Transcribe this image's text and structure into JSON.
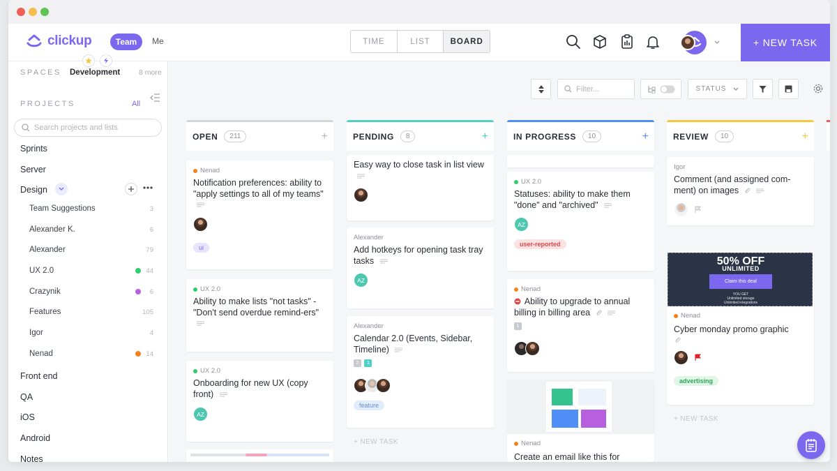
{
  "app": {
    "logo_text": "clickup",
    "team_label": "Team",
    "me_label": "Me",
    "new_task_label": "+ NEW TASK",
    "accent": "#7b68ee"
  },
  "views": [
    {
      "label": "TIME",
      "active": false
    },
    {
      "label": "LIST",
      "active": false
    },
    {
      "label": "BOARD",
      "active": true
    }
  ],
  "top_icons": [
    "search-icon",
    "box-icon",
    "clipboard-icon",
    "bell-icon"
  ],
  "sidebar": {
    "spaces_label": "SPACES",
    "space_name": "Development",
    "more_label": "8 more",
    "projects_label": "PROJECTS",
    "all_label": "All",
    "search_placeholder": "Search projects and lists",
    "projects": [
      {
        "label": "Sprints"
      },
      {
        "label": "Server"
      },
      {
        "label": "Design"
      }
    ],
    "design_lists": [
      {
        "label": "Team Suggestions",
        "count": "3",
        "color": ""
      },
      {
        "label": "Alexander K.",
        "count": "6",
        "color": ""
      },
      {
        "label": "Alexander",
        "count": "79",
        "color": ""
      },
      {
        "label": "UX 2.0",
        "count": "44",
        "color": "#2ecd6f"
      },
      {
        "label": "Crazynik",
        "count": "6",
        "color": "#b660e0"
      },
      {
        "label": "Features",
        "count": "105",
        "color": ""
      },
      {
        "label": "Igor",
        "count": "4",
        "color": ""
      },
      {
        "label": "Nenad",
        "count": "14",
        "color": "#f58220"
      }
    ],
    "more_projects": [
      {
        "label": "Front end"
      },
      {
        "label": "QA"
      },
      {
        "label": "iOS"
      },
      {
        "label": "Android"
      },
      {
        "label": "Notes"
      }
    ]
  },
  "toolbar": {
    "filter_placeholder": "Filter...",
    "status_label": "STATUS"
  },
  "columns": [
    {
      "title": "OPEN",
      "count": "211",
      "color": "#d3d5d9",
      "add_color": "#b4b6bc"
    },
    {
      "title": "PENDING",
      "count": "8",
      "color": "#4fd1c5",
      "add_color": "#4fd1c5"
    },
    {
      "title": "IN PROGRESS",
      "count": "10",
      "color": "#4f8ef7",
      "add_color": "#4f8ef7"
    },
    {
      "title": "REVIEW",
      "count": "10",
      "color": "#f8c740",
      "add_color": "#f8c740"
    }
  ],
  "cards": {
    "open": [
      {
        "who": "Nenad",
        "dot": "#f58220",
        "title": "Notification preferences: ability to \"apply settings to all of my teams\"",
        "tag": "ui"
      },
      {
        "who": "UX 2.0",
        "dot": "#2ecd6f",
        "title": "Ability to make lists \"not tasks\" - \"Don't send overdue remind-ers\""
      },
      {
        "who": "UX 2.0",
        "dot": "#2ecd6f",
        "title": "Onboarding for new UX (copy front)",
        "avatar": "AZ"
      }
    ],
    "pending": [
      {
        "title": "Easy way to close task in list view"
      },
      {
        "who": "Alexander",
        "title": "Add hotkeys for opening task tray tasks",
        "avatar": "AZ"
      },
      {
        "who": "Alexander",
        "title": "Calendar 2.0 (Events, Sidebar, Timeline)",
        "sq1": "2",
        "sq2": "1",
        "tag": "feature"
      }
    ],
    "pending_new": "+ NEW TASK",
    "in_progress": [
      {
        "who": "UX 2.0",
        "dot": "#2ecd6f",
        "title": "Statuses: ability to make them \"done\" and \"archived\"",
        "avatar": "AZ",
        "tag": "user-reported"
      },
      {
        "who": "Nenad",
        "dot": "#f58220",
        "title": "Ability to upgrade to annual billing in billing area",
        "sq1": "1"
      },
      {
        "who": "Nenad",
        "dot": "#f58220",
        "title": "Create an email like this for"
      }
    ],
    "review": [
      {
        "who": "Igor",
        "title": "Comment (and assigned com-ment) on images"
      },
      {
        "who": "Nenad",
        "dot": "#f58220",
        "title": "Cyber monday promo graphic",
        "tag": "advertising"
      }
    ],
    "review_new": "+ NEW TASK"
  },
  "promo": {
    "headline": "50% OFF",
    "sub": "UNLIMITED",
    "button": "Claim this deal",
    "you_get": "YOU GET",
    "line1": "Unlimited storage",
    "line2": "Unlimited integrations"
  }
}
